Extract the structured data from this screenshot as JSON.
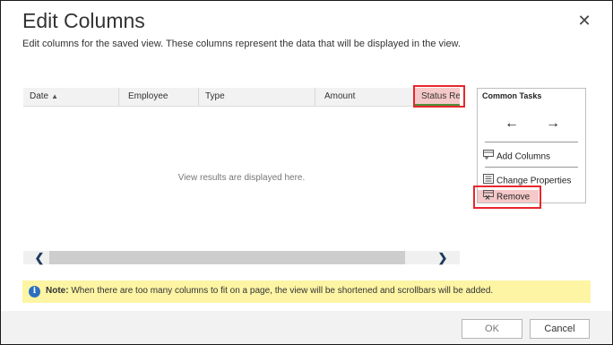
{
  "dialog": {
    "title": "Edit Columns",
    "close_glyph": "✕",
    "description": "Edit columns for the saved view. These columns represent the data that will be displayed in the view."
  },
  "grid": {
    "columns": [
      {
        "label": "Date",
        "sort": "ascending"
      },
      {
        "label": "Employee"
      },
      {
        "label": "Type"
      },
      {
        "label": "Amount"
      },
      {
        "label": "Status Rea"
      }
    ],
    "sort_glyph": "▲",
    "empty_message": "View results are displayed here.",
    "scroll_left_glyph": "❮",
    "scroll_right_glyph": "❯"
  },
  "common_tasks": {
    "title": "Common Tasks",
    "move_left_glyph": "←",
    "move_right_glyph": "→",
    "items": [
      {
        "label": "Add Columns",
        "icon": "add-columns-icon"
      },
      {
        "label": "Change Properties",
        "icon": "change-properties-icon"
      },
      {
        "label": "Remove",
        "icon": "remove-icon"
      }
    ]
  },
  "note": {
    "icon": "info-icon",
    "icon_glyph": "i",
    "label": "Note:",
    "text": " When there are too many columns to fit on a page, the view will be shortened and scrollbars will be added."
  },
  "footer": {
    "ok_label": "OK",
    "cancel_label": "Cancel"
  },
  "colors": {
    "highlight_border": "#e8262c",
    "highlight_fill": "#f5c9c9",
    "note_background": "#fdf5a4",
    "info_blue": "#2b70c0"
  }
}
